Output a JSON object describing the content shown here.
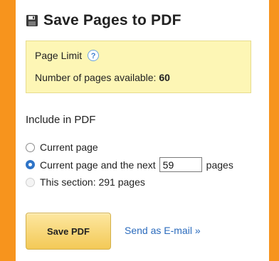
{
  "header": {
    "title": "Save Pages to PDF",
    "icon": "floppy-disk-icon"
  },
  "page_limit": {
    "title": "Page Limit",
    "help_icon": "?",
    "available_label": "Number of pages available:",
    "available_count": "60"
  },
  "include": {
    "label": "Include in PDF",
    "options": {
      "current_page": {
        "label": "Current page",
        "checked": false
      },
      "current_and_next": {
        "label_before": "Current page and the next",
        "value": "59",
        "label_after": "pages",
        "checked": true
      },
      "section": {
        "label": "This section: 291 pages",
        "checked": false,
        "disabled": true
      }
    }
  },
  "actions": {
    "save_label": "Save PDF",
    "email_label": "Send as E-mail »"
  },
  "colors": {
    "background": "#f7941d",
    "panel": "#ffffff",
    "limit_box": "#fdf6b5",
    "link": "#2b6bbd",
    "button": "#f3c957"
  }
}
